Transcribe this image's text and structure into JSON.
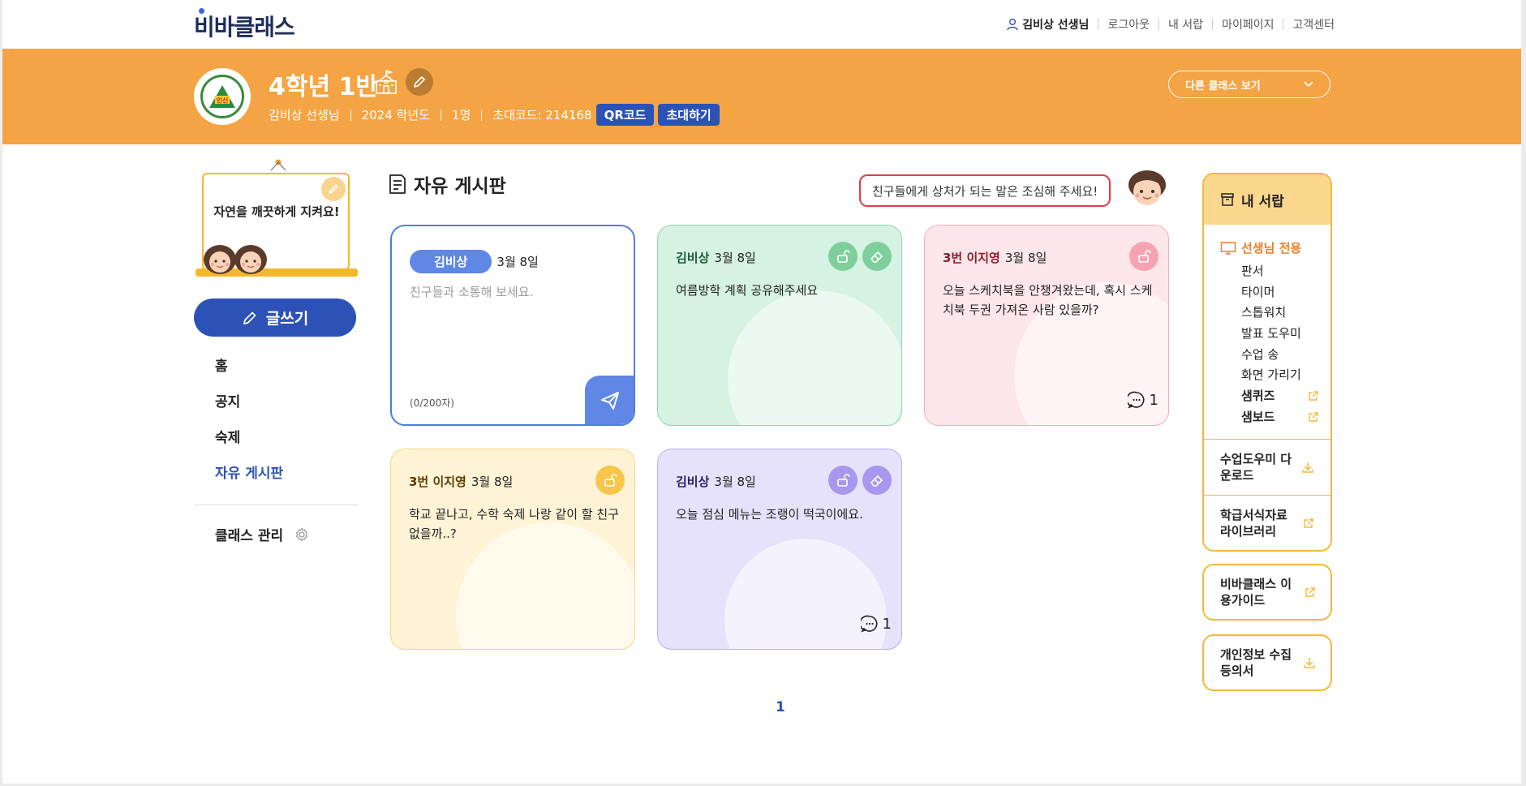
{
  "header": {
    "logo": "비바클래스",
    "user": "김비상 선생님",
    "links": [
      "로그아웃",
      "내 서랍",
      "마이페이지",
      "고객센터"
    ]
  },
  "class": {
    "badge_text": "인신",
    "title": "4학년 1반",
    "teacher": "김비상 선생님",
    "year": "2024 학년도",
    "members": "1명",
    "invite_code": "초대코드: 214168",
    "qr_label": "QR코드",
    "invite_label": "초대하기",
    "other_class_label": "다른 클래스 보기"
  },
  "sidebar": {
    "notice": "자연을 깨끗하게 지켜요!",
    "write_label": "글쓰기",
    "nav": [
      "홈",
      "공지",
      "숙제",
      "자유 게시판"
    ],
    "active_nav": "자유 게시판",
    "manage_label": "클래스 관리"
  },
  "board": {
    "title": "자유 게시판",
    "warning": "친구들에게 상처가 되는 말은 조심해 주세요!",
    "composer": {
      "author": "김비상",
      "date": "3월 8일",
      "placeholder": "친구들과 소통해 보세요.",
      "counter": "(0/200자)"
    },
    "posts": [
      {
        "author": "김비상",
        "date": "3월 8일",
        "text": "여름방학 계획 공유해주세요",
        "comments": "",
        "theme": "green",
        "editable": true
      },
      {
        "author": "3번 이지영",
        "date": "3월 8일",
        "text": "오늘 스케치북을 안챙겨왔는데, 혹시 스케치북 두권 가져온 사람 있을까?",
        "comments": "1",
        "theme": "pink",
        "editable": false
      },
      {
        "author": "3번 이지영",
        "date": "3월 8일",
        "text": "학교 끝나고, 수학 숙제 나랑 같이 할 친구 없을까..?",
        "comments": "",
        "theme": "yellow",
        "editable": false
      },
      {
        "author": "김비상",
        "date": "3월 8일",
        "text": "오늘 점심 메뉴는 조랭이 떡국이에요.",
        "comments": "1",
        "theme": "purple",
        "editable": true
      }
    ],
    "page": "1"
  },
  "drawer": {
    "title": "내 서랍",
    "teacher_only": "선생님 전용",
    "tools": [
      "판서",
      "타이머",
      "스톱워치",
      "발표 도우미",
      "수업 송",
      "화면 가리기"
    ],
    "external_tools": [
      "샘퀴즈",
      "샘보드"
    ],
    "download_label": "수업도우미 다운로드",
    "library_label": "학급서식자료 라이브러리",
    "guide_label": "비바클래스 이용가이드",
    "privacy_label": "개인정보 수집 등의서"
  },
  "colors": {
    "brand": "#2d52b7",
    "banner": "#f4a444",
    "accent": "#f4b93a"
  }
}
